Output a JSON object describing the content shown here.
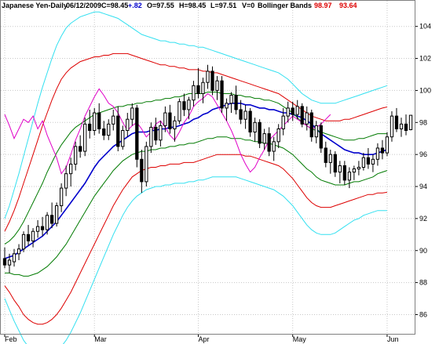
{
  "header": {
    "title": "Japanese Yen-Daily",
    "date": "06/12/2009",
    "close_label": "C=98.45",
    "change": "+.82",
    "open_label": "O=97.55",
    "high_label": "H=98.45",
    "low_label": "L=97.51",
    "volume_label": "V=0",
    "indicator": "Bollinger Bands",
    "upper_value": "98.97",
    "lower_value": "93.64"
  },
  "colors": {
    "candle": "#000000",
    "ma_blue": "#0000cc",
    "band_green": "#007a00",
    "band_red": "#dd0000",
    "band_cyan": "#33e0f0",
    "magenta": "#e000c8",
    "grid": "#c8c8c8",
    "change_text": "#0000cc",
    "upper_text": "#dd0000",
    "lower_text": "#dd0000"
  },
  "chart_data": {
    "type": "candlestick",
    "ylim": [
      84.8,
      105.6
    ],
    "y_ticks": [
      86,
      88,
      90,
      92,
      94,
      96,
      98,
      100,
      102,
      104
    ],
    "x_ticks": [
      {
        "label": "Feb",
        "index": 0
      },
      {
        "label": "Mar",
        "index": 19
      },
      {
        "label": "Apr",
        "index": 41
      },
      {
        "label": "May",
        "index": 61
      },
      {
        "label": "Jun",
        "index": 81
      }
    ],
    "candles": [
      [
        89.5,
        90.2,
        88.9,
        89.1
      ],
      [
        89.1,
        89.8,
        88.6,
        89.4
      ],
      [
        89.3,
        90.1,
        89.0,
        89.8
      ],
      [
        89.8,
        90.4,
        89.4,
        90.1
      ],
      [
        90.1,
        91.2,
        89.9,
        91.0
      ],
      [
        91.0,
        91.6,
        90.3,
        90.6
      ],
      [
        90.6,
        91.4,
        90.2,
        91.2
      ],
      [
        91.2,
        91.9,
        90.8,
        91.5
      ],
      [
        91.5,
        92.1,
        90.9,
        91.3
      ],
      [
        91.3,
        92.4,
        91.0,
        92.2
      ],
      [
        92.2,
        93.0,
        91.4,
        91.7
      ],
      [
        91.7,
        93.0,
        91.5,
        92.8
      ],
      [
        92.8,
        94.2,
        92.4,
        93.9
      ],
      [
        93.9,
        95.3,
        93.4,
        94.8
      ],
      [
        94.8,
        95.8,
        94.0,
        95.4
      ],
      [
        95.4,
        96.8,
        95.0,
        96.5
      ],
      [
        96.5,
        97.2,
        95.8,
        96.2
      ],
      [
        96.2,
        98.3,
        95.9,
        97.9
      ],
      [
        97.9,
        98.8,
        97.0,
        97.5
      ],
      [
        97.5,
        98.9,
        97.2,
        98.6
      ],
      [
        98.6,
        99.2,
        97.3,
        97.6
      ],
      [
        97.6,
        98.1,
        96.9,
        97.2
      ],
      [
        97.2,
        98.2,
        96.9,
        97.9
      ],
      [
        97.9,
        98.8,
        97.5,
        98.4
      ],
      [
        98.4,
        99.0,
        96.2,
        96.5
      ],
      [
        96.5,
        97.8,
        96.3,
        97.5
      ],
      [
        97.5,
        98.6,
        97.1,
        98.2
      ],
      [
        98.2,
        99.2,
        97.8,
        98.9
      ],
      [
        98.9,
        99.1,
        95.2,
        95.7
      ],
      [
        95.7,
        96.3,
        93.6,
        94.3
      ],
      [
        94.3,
        96.8,
        94.0,
        96.5
      ],
      [
        96.5,
        98.0,
        96.1,
        97.7
      ],
      [
        97.7,
        98.3,
        96.6,
        96.9
      ],
      [
        96.9,
        98.1,
        96.5,
        97.8
      ],
      [
        97.8,
        99.0,
        97.4,
        98.6
      ],
      [
        98.6,
        99.1,
        97.3,
        97.6
      ],
      [
        97.6,
        98.4,
        96.8,
        98.1
      ],
      [
        98.1,
        99.5,
        97.9,
        99.3
      ],
      [
        99.3,
        99.8,
        98.4,
        98.8
      ],
      [
        98.8,
        99.6,
        98.2,
        99.4
      ],
      [
        99.4,
        100.6,
        99.0,
        100.3
      ],
      [
        100.3,
        101.4,
        99.5,
        99.8
      ],
      [
        99.8,
        100.8,
        99.2,
        100.5
      ],
      [
        100.5,
        101.6,
        100.1,
        101.2
      ],
      [
        101.2,
        101.5,
        99.7,
        100.0
      ],
      [
        100.0,
        100.9,
        99.4,
        100.6
      ],
      [
        100.6,
        100.9,
        98.6,
        98.9
      ],
      [
        98.9,
        99.5,
        98.1,
        99.2
      ],
      [
        99.2,
        99.9,
        98.6,
        99.7
      ],
      [
        99.7,
        100.3,
        98.5,
        98.8
      ],
      [
        98.8,
        99.4,
        97.9,
        98.2
      ],
      [
        98.2,
        99.1,
        97.6,
        98.7
      ],
      [
        98.7,
        98.9,
        97.1,
        97.4
      ],
      [
        97.4,
        98.3,
        96.8,
        98.0
      ],
      [
        98.0,
        98.2,
        96.4,
        96.7
      ],
      [
        96.7,
        97.6,
        96.3,
        97.3
      ],
      [
        97.3,
        97.7,
        95.9,
        96.2
      ],
      [
        96.2,
        97.1,
        95.6,
        96.8
      ],
      [
        96.8,
        97.9,
        96.4,
        97.6
      ],
      [
        97.6,
        98.9,
        97.2,
        98.4
      ],
      [
        98.4,
        99.3,
        98.0,
        98.9
      ],
      [
        98.9,
        99.3,
        98.1,
        98.5
      ],
      [
        98.5,
        99.4,
        98.2,
        99.0
      ],
      [
        99.0,
        99.2,
        97.7,
        97.9
      ],
      [
        97.9,
        99.0,
        97.5,
        98.6
      ],
      [
        98.6,
        98.8,
        96.8,
        97.1
      ],
      [
        97.1,
        98.1,
        96.7,
        97.8
      ],
      [
        97.8,
        98.0,
        96.1,
        96.4
      ],
      [
        96.4,
        96.8,
        95.2,
        95.5
      ],
      [
        95.5,
        96.3,
        94.8,
        96.0
      ],
      [
        96.0,
        96.2,
        94.6,
        94.9
      ],
      [
        94.9,
        95.6,
        94.2,
        95.3
      ],
      [
        95.3,
        95.6,
        94.1,
        94.4
      ],
      [
        94.4,
        95.2,
        93.9,
        94.9
      ],
      [
        94.9,
        95.3,
        94.4,
        95.1
      ],
      [
        95.1,
        95.6,
        94.7,
        95.2
      ],
      [
        95.2,
        96.1,
        95.0,
        95.8
      ],
      [
        95.8,
        96.4,
        95.1,
        95.4
      ],
      [
        95.4,
        96.0,
        94.9,
        95.7
      ],
      [
        95.7,
        96.7,
        95.3,
        96.4
      ],
      [
        96.4,
        96.9,
        95.7,
        96.1
      ],
      [
        96.1,
        97.4,
        95.9,
        97.1
      ],
      [
        97.1,
        98.7,
        96.8,
        98.4
      ],
      [
        98.4,
        98.9,
        97.4,
        97.6
      ],
      [
        97.6,
        98.3,
        97.1,
        97.9
      ],
      [
        97.9,
        98.5,
        97.2,
        97.5
      ],
      [
        97.55,
        98.45,
        97.51,
        98.45
      ]
    ],
    "series": [
      {
        "type": "line",
        "color": "#0000cc",
        "values": [
          89.5,
          89.6,
          89.7,
          89.9,
          90.1,
          90.3,
          90.5,
          90.7,
          90.9,
          91.2,
          91.5,
          91.8,
          92.2,
          92.6,
          93.0,
          93.4,
          93.8,
          94.2,
          94.7,
          95.2,
          95.6,
          95.9,
          96.2,
          96.5,
          96.7,
          96.9,
          97.1,
          97.3,
          97.4,
          97.4,
          97.4,
          97.5,
          97.5,
          97.6,
          97.6,
          97.7,
          97.7,
          97.8,
          97.9,
          98.0,
          98.2,
          98.3,
          98.5,
          98.6,
          98.8,
          98.9,
          99.0,
          99.1,
          99.2,
          99.2,
          99.2,
          99.1,
          99.1,
          99.0,
          98.9,
          98.9,
          98.8,
          98.8,
          98.7,
          98.6,
          98.6,
          98.5,
          98.4,
          98.3,
          98.1,
          97.9,
          97.6,
          97.3,
          97.1,
          96.9,
          96.7,
          96.5,
          96.3,
          96.2,
          96.1,
          96.1,
          96.0,
          96.0,
          96.0,
          96.1,
          96.2,
          96.3
        ]
      },
      {
        "type": "line",
        "color": "#007a00",
        "values": [
          90.4,
          90.6,
          90.9,
          91.3,
          91.8,
          92.4,
          93.0,
          93.6,
          94.2,
          94.9,
          95.5,
          96.1,
          96.6,
          97.0,
          97.4,
          97.7,
          97.9,
          98.1,
          98.3,
          98.5,
          98.6,
          98.7,
          98.8,
          98.9,
          99.0,
          99.0,
          99.1,
          99.1,
          99.2,
          99.2,
          99.3,
          99.3,
          99.4,
          99.4,
          99.5,
          99.5,
          99.6,
          99.6,
          99.7,
          99.8,
          99.8,
          99.8,
          99.8,
          99.9,
          99.9,
          99.9,
          99.8,
          99.8,
          99.8,
          99.7,
          99.7,
          99.6,
          99.6,
          99.5,
          99.5,
          99.4,
          99.4,
          99.3,
          99.2,
          99.0,
          98.8,
          98.6,
          98.3,
          98.0,
          97.8,
          97.6,
          97.5,
          97.4,
          97.3,
          97.2,
          97.1,
          97.0,
          96.9,
          96.9,
          96.9,
          97.0,
          97.0,
          97.1,
          97.2,
          97.3,
          97.3,
          97.3
        ]
      },
      {
        "type": "line",
        "color": "#007a00",
        "values": [
          88.6,
          88.6,
          88.5,
          88.5,
          88.4,
          88.4,
          88.5,
          88.6,
          88.8,
          89.0,
          89.3,
          89.6,
          90.0,
          90.4,
          90.9,
          91.4,
          91.9,
          92.4,
          92.9,
          93.4,
          93.8,
          94.2,
          94.6,
          95.0,
          95.3,
          95.6,
          95.8,
          96.0,
          96.1,
          96.2,
          96.2,
          96.3,
          96.3,
          96.4,
          96.4,
          96.5,
          96.5,
          96.6,
          96.6,
          96.7,
          96.7,
          96.8,
          96.9,
          97.0,
          97.0,
          97.1,
          97.1,
          97.1,
          97.0,
          97.0,
          97.0,
          96.9,
          96.9,
          96.8,
          96.8,
          96.7,
          96.7,
          96.6,
          96.5,
          96.4,
          96.2,
          96.0,
          95.7,
          95.4,
          95.1,
          94.9,
          94.6,
          94.4,
          94.3,
          94.2,
          94.1,
          94.1,
          94.1,
          94.2,
          94.3,
          94.3,
          94.4,
          94.5,
          94.6,
          94.8,
          94.9,
          95.0
        ]
      },
      {
        "type": "line",
        "color": "#dd0000",
        "values": [
          91.2,
          91.8,
          92.5,
          93.3,
          94.2,
          95.1,
          96.0,
          96.9,
          97.8,
          98.6,
          99.4,
          100.1,
          100.7,
          101.1,
          101.4,
          101.6,
          101.8,
          101.9,
          102.0,
          102.1,
          102.1,
          102.2,
          102.2,
          102.3,
          102.3,
          102.3,
          102.3,
          102.2,
          102.1,
          102.0,
          101.9,
          101.8,
          101.7,
          101.6,
          101.6,
          101.5,
          101.5,
          101.4,
          101.4,
          101.3,
          101.3,
          101.3,
          101.2,
          101.2,
          101.1,
          101.1,
          101.0,
          100.9,
          100.8,
          100.7,
          100.6,
          100.5,
          100.4,
          100.3,
          100.2,
          100.1,
          100.0,
          99.9,
          99.8,
          99.6,
          99.4,
          99.2,
          99.0,
          98.8,
          98.6,
          98.4,
          98.3,
          98.2,
          98.1,
          98.1,
          98.1,
          98.1,
          98.2,
          98.2,
          98.3,
          98.4,
          98.5,
          98.6,
          98.7,
          98.8,
          98.9,
          98.97
        ]
      },
      {
        "type": "line",
        "color": "#dd0000",
        "values": [
          87.8,
          87.4,
          86.9,
          86.5,
          86.0,
          85.7,
          85.5,
          85.4,
          85.4,
          85.5,
          85.7,
          86.0,
          86.4,
          86.9,
          87.4,
          88.0,
          88.6,
          89.2,
          89.8,
          90.4,
          91.0,
          91.6,
          92.2,
          92.8,
          93.3,
          93.8,
          94.2,
          94.6,
          94.8,
          95.0,
          95.1,
          95.2,
          95.2,
          95.3,
          95.3,
          95.4,
          95.4,
          95.4,
          95.5,
          95.5,
          95.5,
          95.6,
          95.7,
          95.8,
          95.9,
          96.0,
          96.0,
          96.0,
          96.0,
          96.0,
          96.0,
          95.9,
          95.9,
          95.8,
          95.7,
          95.6,
          95.5,
          95.4,
          95.3,
          95.1,
          94.8,
          94.5,
          94.1,
          93.7,
          93.3,
          93.0,
          92.8,
          92.7,
          92.7,
          92.7,
          92.8,
          92.9,
          93.0,
          93.1,
          93.2,
          93.3,
          93.4,
          93.5,
          93.5,
          93.6,
          93.6,
          93.64
        ]
      },
      {
        "type": "line",
        "color": "#33e0f0",
        "values": [
          92.0,
          92.8,
          93.8,
          94.8,
          95.9,
          97.0,
          98.1,
          99.2,
          100.2,
          101.1,
          102.0,
          102.8,
          103.4,
          103.9,
          104.2,
          104.4,
          104.6,
          104.7,
          104.8,
          104.9,
          104.9,
          104.8,
          104.7,
          104.6,
          104.5,
          104.3,
          104.1,
          103.9,
          103.7,
          103.5,
          103.4,
          103.3,
          103.2,
          103.1,
          103.1,
          103.0,
          103.0,
          102.9,
          102.9,
          102.8,
          102.8,
          102.7,
          102.7,
          102.6,
          102.5,
          102.4,
          102.3,
          102.2,
          102.1,
          102.0,
          101.9,
          101.8,
          101.7,
          101.6,
          101.5,
          101.4,
          101.3,
          101.2,
          101.1,
          100.9,
          100.7,
          100.4,
          100.1,
          99.8,
          99.6,
          99.4,
          99.3,
          99.2,
          99.2,
          99.2,
          99.2,
          99.3,
          99.4,
          99.5,
          99.6,
          99.7,
          99.8,
          99.9,
          100.0,
          100.1,
          100.2,
          100.3
        ]
      },
      {
        "type": "line",
        "color": "#33e0f0",
        "values": [
          87.0,
          86.3,
          85.6,
          85.0,
          84.4,
          84.0,
          83.7,
          83.5,
          83.4,
          83.4,
          83.5,
          83.7,
          84.0,
          84.4,
          84.9,
          85.5,
          86.1,
          86.8,
          87.5,
          88.2,
          88.9,
          89.6,
          90.3,
          91.0,
          91.6,
          92.2,
          92.7,
          93.1,
          93.4,
          93.6,
          93.8,
          93.9,
          94.0,
          94.0,
          94.1,
          94.1,
          94.2,
          94.2,
          94.2,
          94.3,
          94.3,
          94.4,
          94.4,
          94.5,
          94.6,
          94.6,
          94.6,
          94.6,
          94.6,
          94.6,
          94.5,
          94.4,
          94.3,
          94.2,
          94.1,
          94.0,
          93.9,
          93.8,
          93.6,
          93.4,
          93.1,
          92.8,
          92.4,
          92.0,
          91.6,
          91.3,
          91.1,
          91.0,
          91.0,
          91.0,
          91.1,
          91.3,
          91.5,
          91.7,
          91.9,
          92.0,
          92.2,
          92.3,
          92.4,
          92.5,
          92.5,
          92.5
        ]
      },
      {
        "type": "line",
        "color": "#e000c8",
        "values": [
          98.5,
          97.8,
          97.0,
          97.6,
          98.2,
          98.0,
          98.4,
          97.6,
          98.1,
          97.2,
          96.5,
          95.8,
          94.8,
          95.2,
          96.0,
          96.9,
          97.6,
          98.4,
          99.0,
          99.6,
          100.1,
          99.7,
          99.2,
          99.0,
          98.6,
          98.0,
          97.5,
          97.8,
          98.0,
          97.6,
          97.1,
          97.4,
          97.9,
          98.1,
          97.7,
          97.2,
          96.9,
          97.4,
          98.0,
          98.4,
          99.0,
          99.3,
          99.5,
          99.8,
          99.6,
          99.1,
          98.6,
          98.1,
          97.5,
          96.8,
          96.0,
          95.4,
          94.9,
          95.2,
          95.8,
          96.3,
          96.9,
          97.2,
          97.5,
          97.8,
          98.1,
          98.4,
          98.2,
          98.0,
          97.8,
          97.6,
          97.7,
          97.9,
          98.2,
          98.5
        ]
      }
    ]
  }
}
